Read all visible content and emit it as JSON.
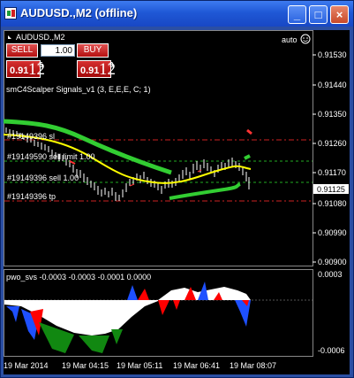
{
  "window": {
    "title": "AUDUSD.,M2 (offline)",
    "min_label": "_",
    "max_label": "□",
    "close_label": "×"
  },
  "chart": {
    "symbol_label": "AUDUSD.,M2",
    "mode_label": "auto",
    "indicator_label": "smC4Scalper Signals_v1 (3, E,E,E, C; 1)",
    "order_labels": [
      "#19149396 sl",
      "#19149590 sell limit 1.00",
      "#19149396 sell 1.00",
      "#19149396 tp"
    ],
    "price_levels": [
      "0.91530",
      "0.91440",
      "0.91350",
      "0.91260",
      "0.91170",
      "0.91080",
      "0.90990",
      "0.90900"
    ],
    "current_price": "0.91125",
    "time_labels": [
      "19 Mar 2014",
      "19 Mar 04:15",
      "19 Mar 05:11",
      "19 Mar 06:41",
      "19 Mar 08:07"
    ],
    "colors": {
      "background": "#000000",
      "trend_up": "#32cd32",
      "ma": "#ffff00",
      "level_red": "#cc2222",
      "level_green": "#22aa22"
    }
  },
  "trade_panel": {
    "sell_label": "SELL",
    "buy_label": "BUY",
    "lot_value": "1.00",
    "sell_quote": {
      "prefix": "0.91",
      "big": "12",
      "sup": "5"
    },
    "buy_quote": {
      "prefix": "0.91",
      "big": "12",
      "sup": "9"
    }
  },
  "subwindow": {
    "indicator_label": "pwo_svs -0.0003 -0.0003 -0.0001 0.0000",
    "scale_top": "0.0003",
    "scale_bottom": "-0.0006",
    "colors": {
      "positive": "#ffffff",
      "negative": "#ffffff",
      "red": "#ff0000",
      "blue": "#1e50ff",
      "green": "#118811"
    }
  }
}
